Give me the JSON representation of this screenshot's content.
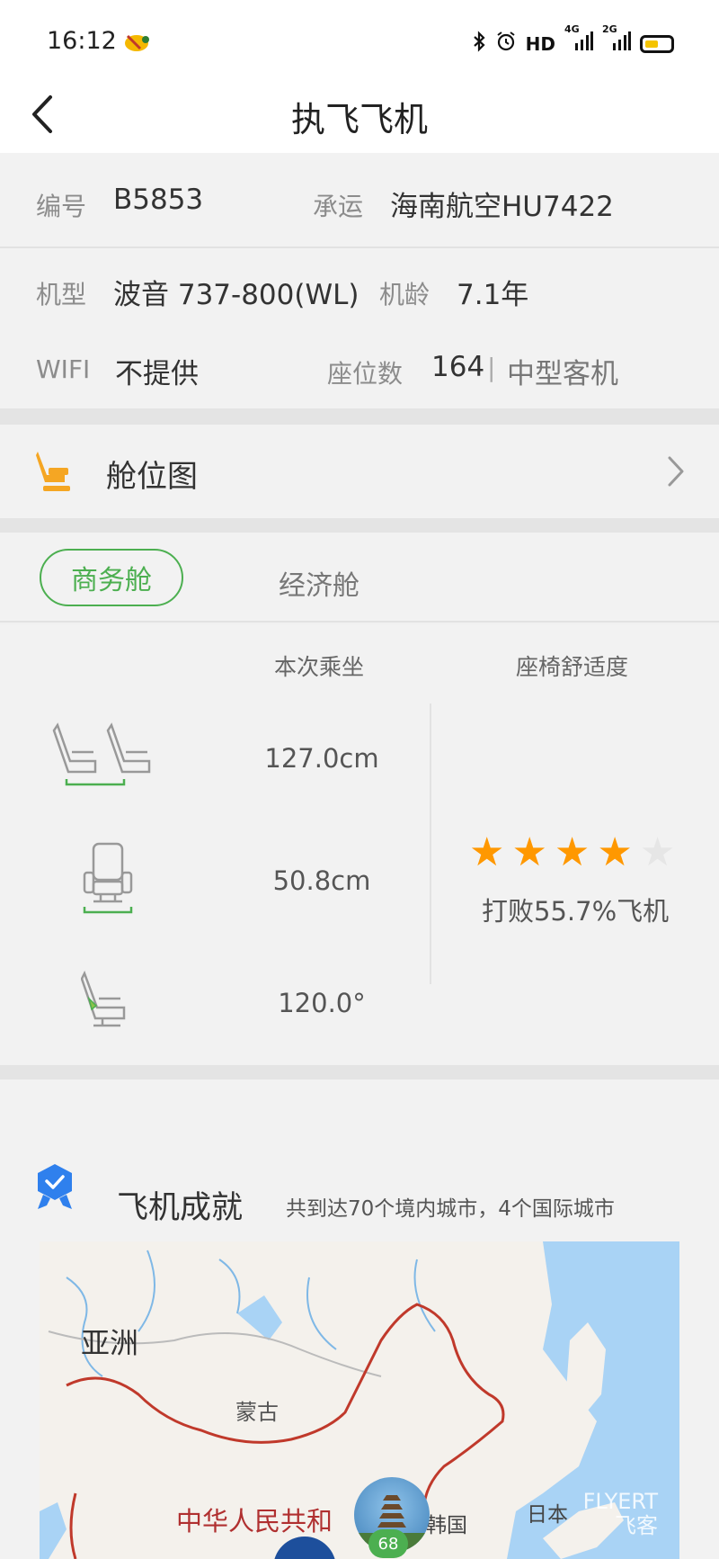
{
  "status_bar": {
    "time": "16:12",
    "network": "HD",
    "signal_4g": "4G",
    "signal_2g": "2G"
  },
  "nav": {
    "title": "执飞飞机"
  },
  "plane_info": {
    "reg_label": "编号",
    "reg_value": "B5853",
    "carrier_label": "承运",
    "carrier_value": "海南航空HU7422",
    "type_label": "机型",
    "type_value": "波音 737-800(WL)",
    "age_label": "机龄",
    "age_value": "7.1年",
    "wifi_label": "WIFI",
    "wifi_value": "不提供",
    "seats_label": "座位数",
    "seats_value": "164",
    "seats_sep": "|",
    "size_value": "中型客机"
  },
  "seat_map": {
    "label": "舱位图"
  },
  "cabin_tabs": {
    "active": "商务舱",
    "inactive": "经济舱"
  },
  "seat_stats": {
    "col_current": "本次乘坐",
    "col_comfort": "座椅舒适度",
    "pitch": "127.0cm",
    "width": "50.8cm",
    "recline": "120.0°",
    "rating": 4,
    "rating_max": 5,
    "beat_text": "打败55.7%飞机",
    "star_color": "#ff9800"
  },
  "achievement": {
    "title": "飞机成就",
    "subtitle": "共到达70个境内城市，4个国际城市",
    "map_labels": {
      "asia": "亚洲",
      "mongolia": "蒙古",
      "china": "中华人民共和",
      "korea": "韩国",
      "japan": "日本"
    },
    "badge_count": "68",
    "watermark_top": "FLYERT",
    "watermark_bottom": "飞客"
  },
  "colors": {
    "accent_green": "#4caf50",
    "accent_orange": "#f5a623",
    "badge_blue": "#2f80ed"
  }
}
